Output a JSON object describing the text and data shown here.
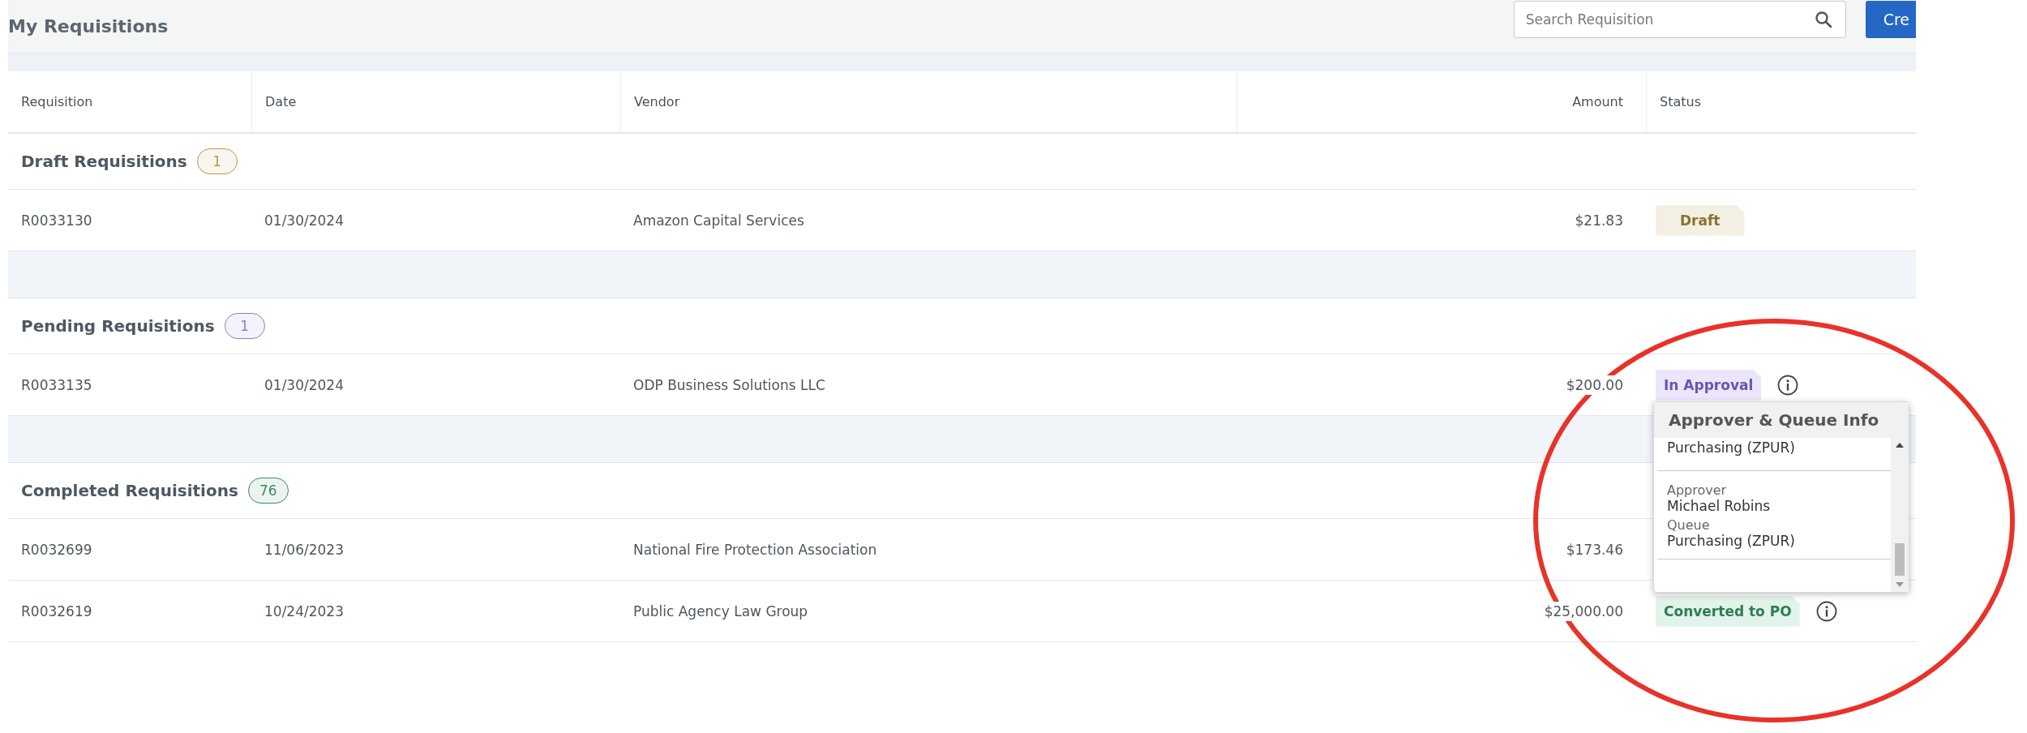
{
  "title": "My Requisitions",
  "search": {
    "placeholder": "Search Requisition"
  },
  "create_button": "Cre",
  "columns": [
    "Requisition",
    "Date",
    "Vendor",
    "Amount",
    "Status"
  ],
  "groups": [
    {
      "title": "Draft Requisitions",
      "count": "1",
      "color": "#b89a4e",
      "rows": [
        {
          "requisition": "R0033130",
          "date": "01/30/2024",
          "vendor": "Amazon Capital Services",
          "amount": "$21.83",
          "status": {
            "label": "Draft",
            "kind": "draft"
          },
          "has_info": false
        }
      ]
    },
    {
      "title": "Pending Requisitions",
      "count": "1",
      "color": "#8a7fcf",
      "rows": [
        {
          "requisition": "R0033135",
          "date": "01/30/2024",
          "vendor": "ODP Business Solutions LLC",
          "amount": "$200.00",
          "status": {
            "label": "In Approval",
            "kind": "in_approval"
          },
          "has_info": true,
          "popup_open": true
        }
      ]
    },
    {
      "title": "Completed Requisitions",
      "count": "76",
      "color": "#3d8a63",
      "rows": [
        {
          "requisition": "R0032699",
          "date": "11/06/2023",
          "vendor": "National Fire Protection Association",
          "amount": "$173.46",
          "status": null,
          "has_info": false
        },
        {
          "requisition": "R0032619",
          "date": "10/24/2023",
          "vendor": "Public Agency Law Group",
          "amount": "$25,000.00",
          "status": {
            "label": "Converted to PO",
            "kind": "converted"
          },
          "has_info": true
        }
      ]
    }
  ],
  "popup": {
    "title": "Approver & Queue Info",
    "sections": [
      {
        "items": [
          {
            "value": "Purchasing (ZPUR)"
          }
        ]
      },
      {
        "items": [
          {
            "label": "Approver",
            "value": "Michael Robins"
          },
          {
            "label": "Queue",
            "value": "Purchasing (ZPUR)"
          }
        ]
      }
    ]
  }
}
